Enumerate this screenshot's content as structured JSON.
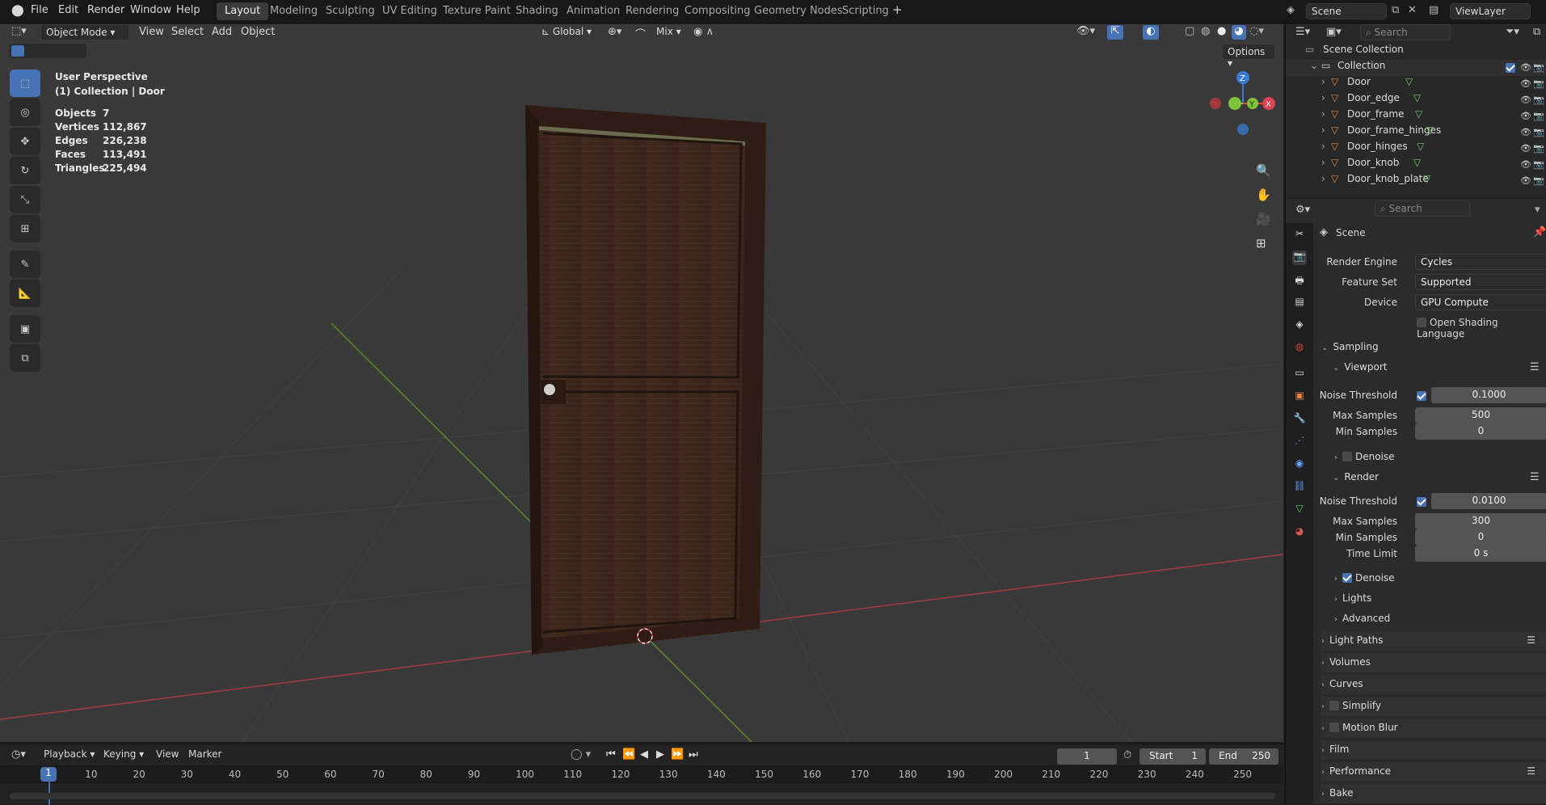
{
  "topbar": {
    "menus": [
      "File",
      "Edit",
      "Render",
      "Window",
      "Help"
    ],
    "workspaces": [
      "Layout",
      "Modeling",
      "Sculpting",
      "UV Editing",
      "Texture Paint",
      "Shading",
      "Animation",
      "Rendering",
      "Compositing",
      "Geometry Nodes",
      "Scripting"
    ],
    "active_workspace": "Layout",
    "add_tab": "+",
    "scene": "Scene",
    "view_layer": "ViewLayer"
  },
  "viewport": {
    "mode": "Object Mode",
    "menus": [
      "View",
      "Select",
      "Add",
      "Object"
    ],
    "orientation": "Global",
    "snap_mode": "Mix",
    "options": "Options",
    "overlay_title": "User Perspective",
    "overlay_subtitle": "(1) Collection | Door",
    "stats": [
      {
        "label": "Objects",
        "value": "7"
      },
      {
        "label": "Vertices",
        "value": "112,867"
      },
      {
        "label": "Edges",
        "value": "226,238"
      },
      {
        "label": "Faces",
        "value": "113,491"
      },
      {
        "label": "Triangles",
        "value": "225,494"
      }
    ],
    "gizmo": {
      "x": "X",
      "y": "Y",
      "z": "Z"
    }
  },
  "timeline": {
    "menus": [
      "Playback",
      "Keying",
      "View",
      "Marker"
    ],
    "current_frame": "1",
    "start_label": "Start",
    "start": "1",
    "end_label": "End",
    "end": "250",
    "ticks": [
      "1",
      "10",
      "20",
      "30",
      "40",
      "50",
      "60",
      "70",
      "80",
      "90",
      "100",
      "110",
      "120",
      "130",
      "140",
      "150",
      "160",
      "170",
      "180",
      "190",
      "200",
      "210",
      "220",
      "230",
      "240",
      "250"
    ]
  },
  "outliner": {
    "search_placeholder": "Search",
    "root": "Scene Collection",
    "collection": "Collection",
    "items": [
      "Door",
      "Door_edge",
      "Door_frame",
      "Door_frame_hinges",
      "Door_hinges",
      "Door_knob",
      "Door_knob_plate"
    ]
  },
  "properties": {
    "search_placeholder": "Search",
    "context": "Scene",
    "render_engine_label": "Render Engine",
    "render_engine": "Cycles",
    "feature_set_label": "Feature Set",
    "feature_set": "Supported",
    "device_label": "Device",
    "device": "GPU Compute",
    "osl_label": "Open Shading Language",
    "sampling": "Sampling",
    "viewport": {
      "title": "Viewport",
      "noise_label": "Noise Threshold",
      "noise": "0.1000",
      "max_label": "Max Samples",
      "max": "500",
      "min_label": "Min Samples",
      "min": "0",
      "denoise": "Denoise"
    },
    "render": {
      "title": "Render",
      "noise_label": "Noise Threshold",
      "noise": "0.0100",
      "max_label": "Max Samples",
      "max": "300",
      "min_label": "Min Samples",
      "min": "0",
      "time_label": "Time Limit",
      "time": "0 s",
      "denoise": "Denoise"
    },
    "lights": "Lights",
    "advanced": "Advanced",
    "panels": [
      "Light Paths",
      "Volumes",
      "Curves",
      "Simplify",
      "Motion Blur",
      "Film",
      "Performance",
      "Bake"
    ]
  },
  "colors": {
    "accent": "#4772b3",
    "x_axis": "#e0414f",
    "y_axis": "#80c23a",
    "z_axis": "#3a7bd9"
  }
}
